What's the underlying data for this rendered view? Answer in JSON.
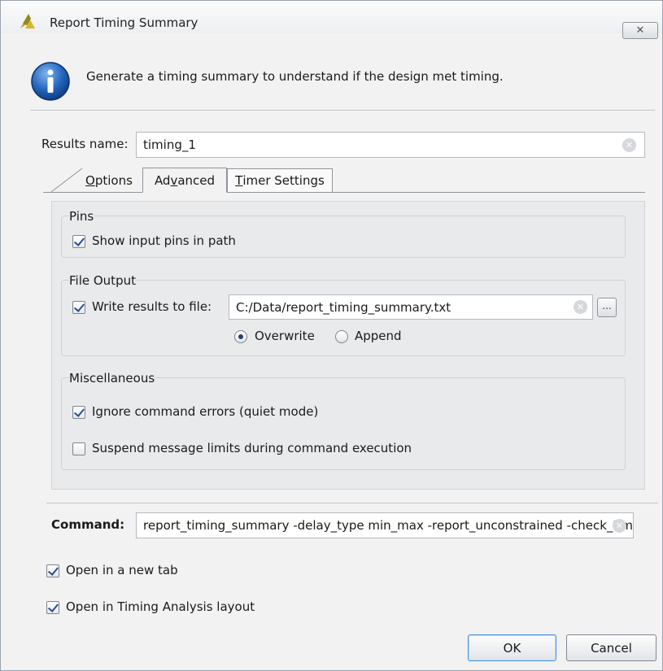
{
  "window": {
    "title": "Report Timing Summary",
    "close_glyph": "✕"
  },
  "header": {
    "description": "Generate a timing summary to understand if the design met timing."
  },
  "results": {
    "label": "Results name:",
    "value": "timing_1"
  },
  "tabs": [
    {
      "label_pre": "",
      "label_key": "O",
      "label_post": "ptions"
    },
    {
      "label_pre": "Ad",
      "label_key": "v",
      "label_post": "anced"
    },
    {
      "label_pre": "",
      "label_key": "T",
      "label_post": "imer Settings"
    }
  ],
  "pins": {
    "title": "Pins",
    "show_input_pins": {
      "label": "Show input pins in path",
      "checked": true
    }
  },
  "file_output": {
    "title": "File Output",
    "write_results": {
      "label": "Write results to file:",
      "checked": true
    },
    "path": "C:/Data/report_timing_summary.txt",
    "browse_label": "...",
    "overwrite": {
      "label": "Overwrite",
      "selected": true
    },
    "append": {
      "label": "Append",
      "selected": false
    }
  },
  "misc": {
    "title": "Miscellaneous",
    "ignore_errors": {
      "label": "Ignore command errors (quiet mode)",
      "checked": true
    },
    "suspend_limits": {
      "label": "Suspend message limits during command execution",
      "checked": false
    }
  },
  "command": {
    "label": "Command:",
    "value": "report_timing_summary -delay_type min_max -report_unconstrained -check_timing_verbose"
  },
  "options": {
    "open_new_tab": {
      "label": "Open in a new tab",
      "checked": true
    },
    "open_timing_layout": {
      "label": "Open in Timing Analysis layout",
      "checked": true
    }
  },
  "buttons": {
    "ok": "OK",
    "cancel": "Cancel"
  },
  "icons": {
    "app": "vivado-leaf-icon",
    "info": "info-icon",
    "clear": "clear-field-icon"
  },
  "colors": {
    "info_blue": "#1f63b6",
    "check_mark": "#2b4e8f",
    "app_icon": "#b7a324"
  }
}
